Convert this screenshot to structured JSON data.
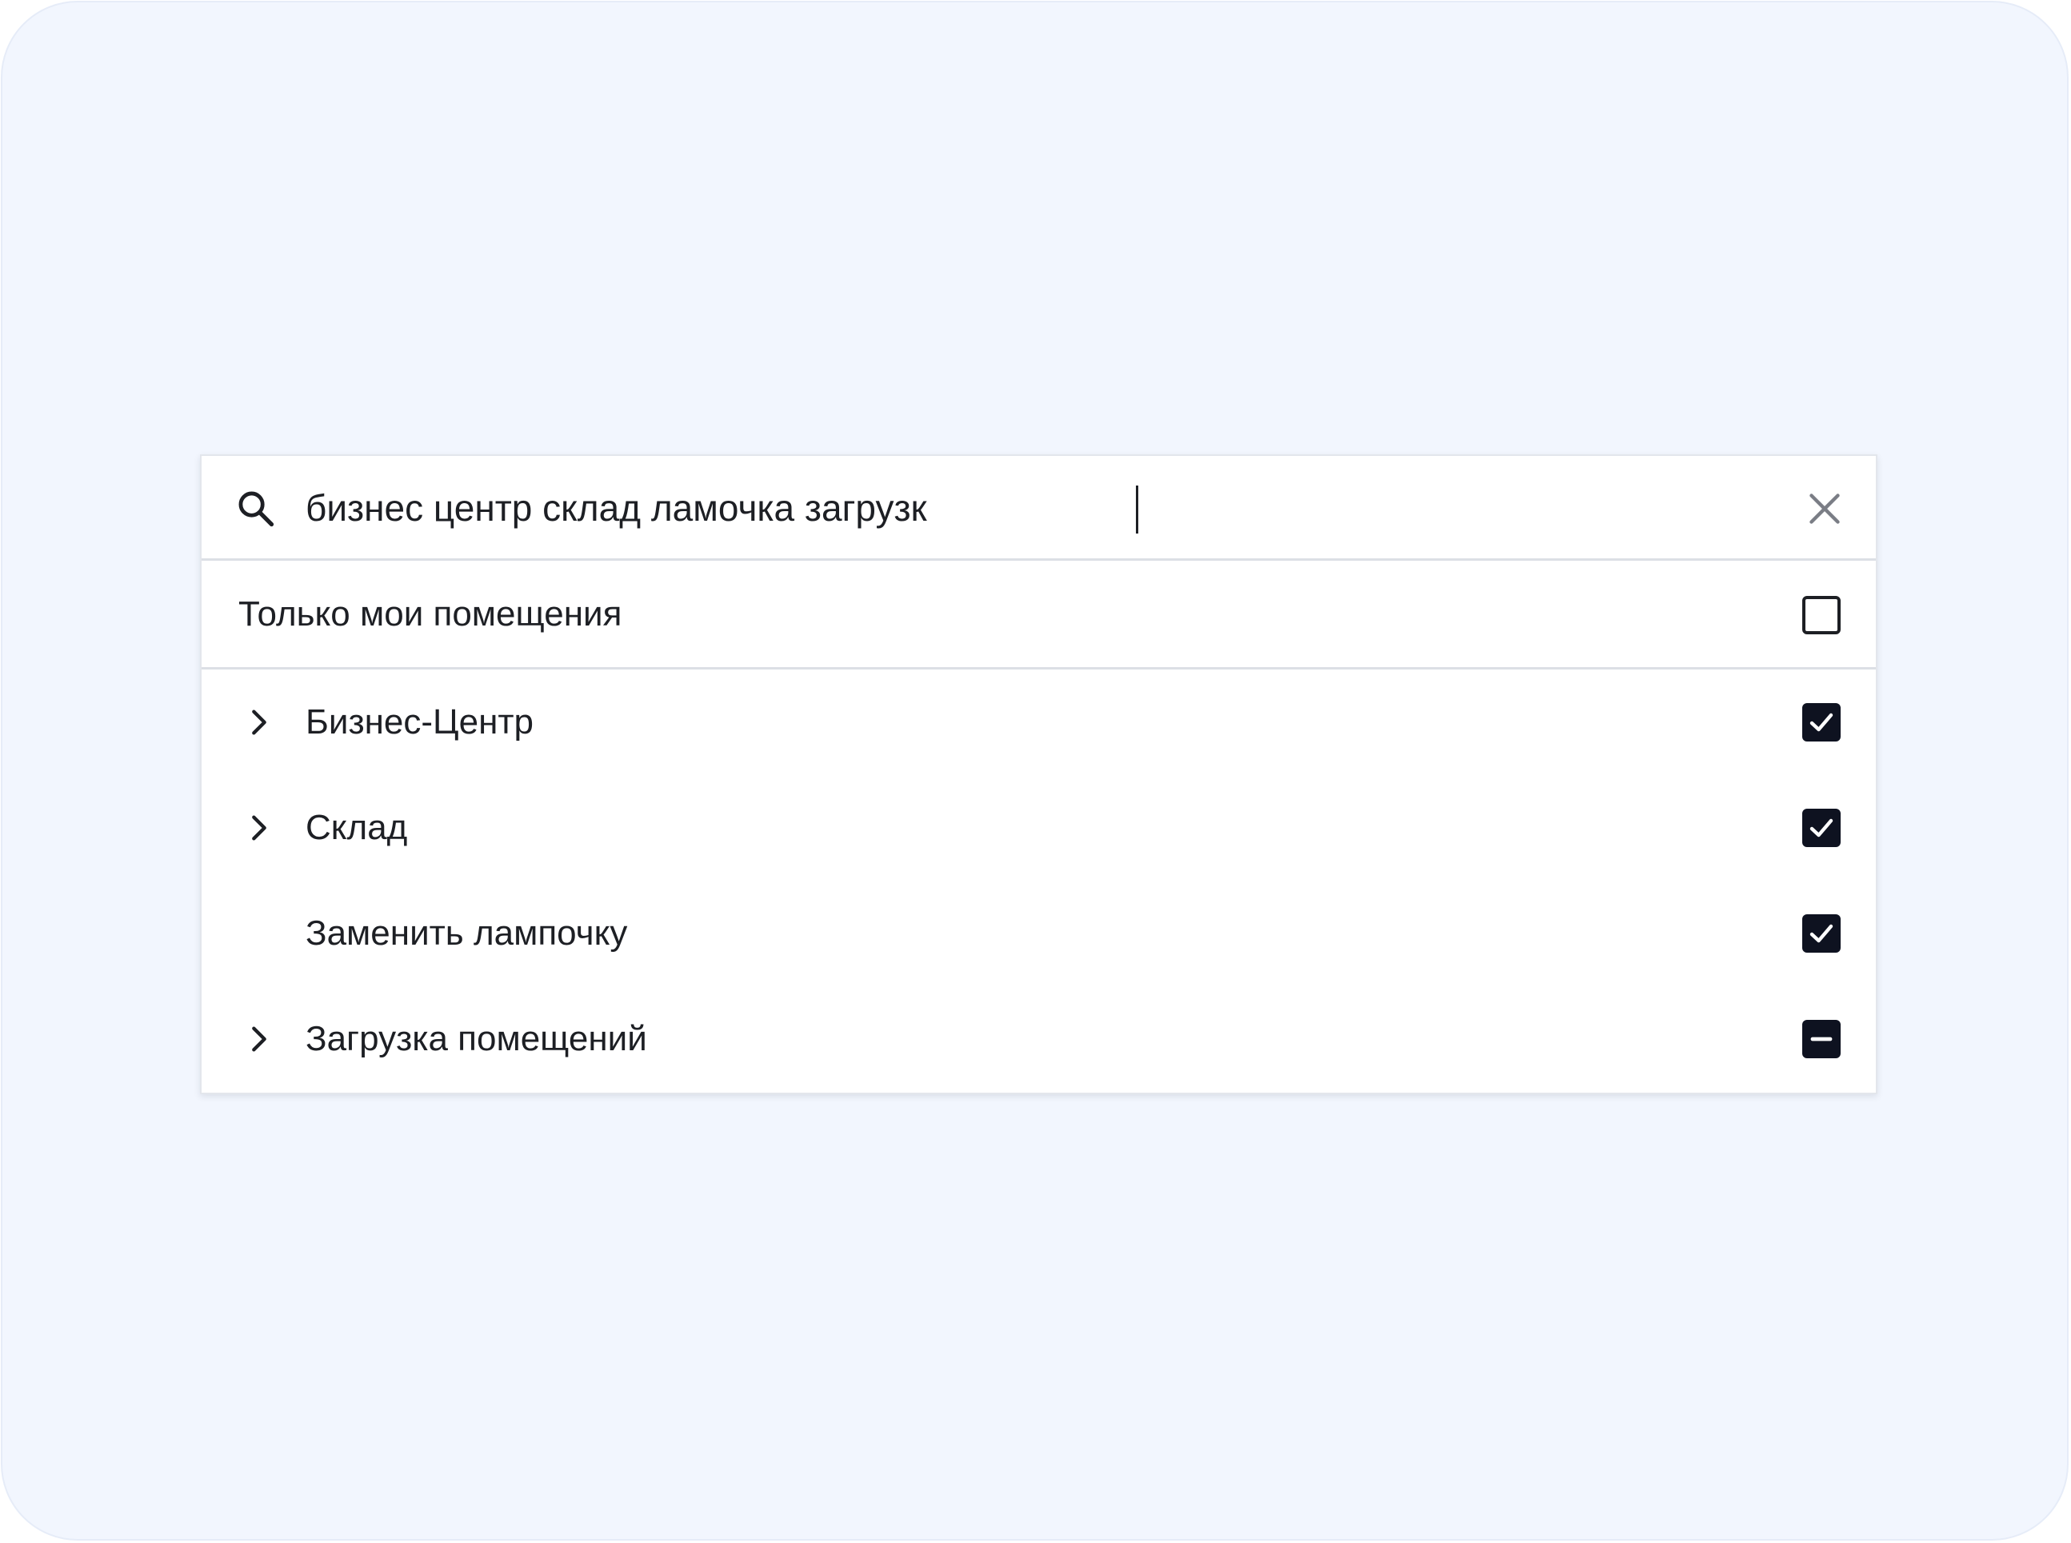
{
  "search": {
    "value": "бизнес центр склад ламочка загрузк",
    "icon": "search-icon",
    "clear_icon": "close-icon"
  },
  "filter": {
    "label": "Только мои помещения",
    "checked": false
  },
  "items": [
    {
      "label": "Бизнес-Центр",
      "expandable": true,
      "state": "checked"
    },
    {
      "label": "Склад",
      "expandable": true,
      "state": "checked"
    },
    {
      "label": "Заменить лампочку",
      "expandable": false,
      "state": "checked"
    },
    {
      "label": "Загрузка помещений",
      "expandable": true,
      "state": "indeterminate"
    }
  ],
  "colors": {
    "background": "#f2f6fe",
    "panel": "#ffffff",
    "text": "#1d1f24",
    "checkbox_fill": "#0e1220",
    "divider": "#dcdfe5",
    "clear_icon": "#7a7d85"
  }
}
